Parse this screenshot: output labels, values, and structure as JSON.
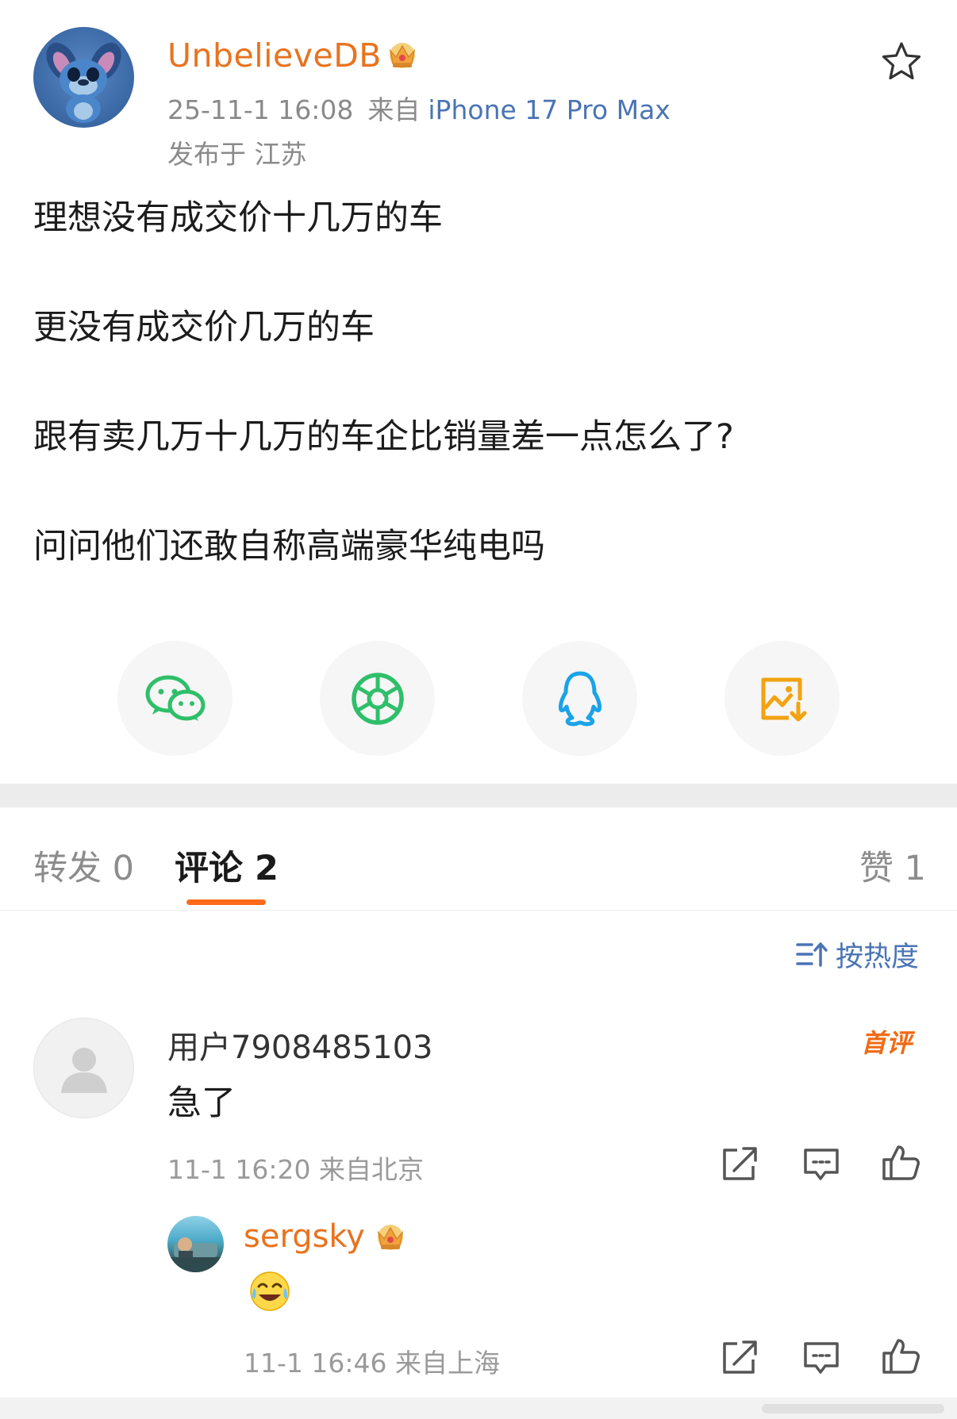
{
  "post": {
    "username": "UnbelieveDB",
    "timestamp": "25-11-1 16:08",
    "from_label": "来自",
    "source": "iPhone 17 Pro Max",
    "location": "发布于 江苏",
    "lines": [
      "理想没有成交价十几万的车",
      "更没有成交价几万的车",
      "跟有卖几万十几万的车企比销量差一点怎么了?",
      "问问他们还敢自称高端豪华纯电吗"
    ]
  },
  "share": {
    "icons": [
      "wechat-icon",
      "moments-icon",
      "qq-icon",
      "save-image-icon"
    ]
  },
  "tabs": {
    "repost": "转发 0",
    "comments": "评论 2",
    "likes": "赞 1"
  },
  "sort": {
    "label": "按热度"
  },
  "comments": [
    {
      "name": "用户7908485103",
      "text": "急了",
      "meta": "11-1 16:20  来自北京",
      "badge": "首评"
    },
    {
      "name": "sergsky",
      "emoji": "laughing-crying-emoji",
      "meta": "11-1 16:46  来自上海"
    }
  ],
  "colors": {
    "accent_orange": "#e8731f",
    "link_blue": "#4a74b5",
    "wechat_green": "#2fbf6a",
    "qq_blue": "#1aa3e8",
    "save_orange": "#f2a311",
    "tab_underline": "#ff6a1a"
  }
}
